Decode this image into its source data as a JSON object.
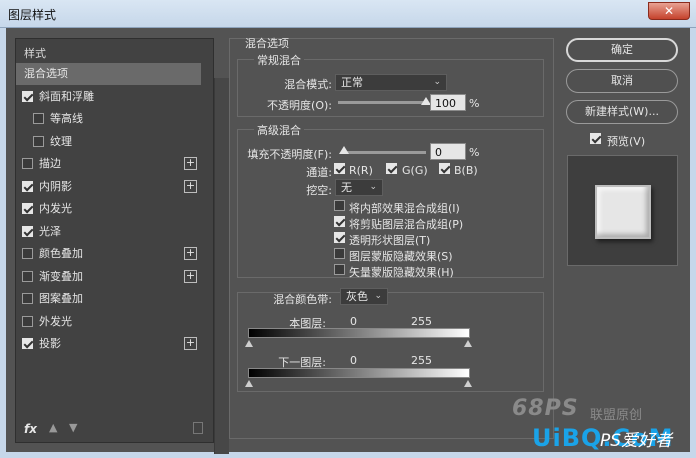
{
  "window": {
    "title": "图层样式",
    "close_label": "✕"
  },
  "left": {
    "header": "样式",
    "items": [
      {
        "label": "混合选项",
        "checkbox": false,
        "checked": false,
        "plus": false,
        "selected": true,
        "indent": 0
      },
      {
        "label": "斜面和浮雕",
        "checkbox": true,
        "checked": true,
        "plus": false,
        "selected": false,
        "indent": 0
      },
      {
        "label": "等高线",
        "checkbox": true,
        "checked": false,
        "plus": false,
        "selected": false,
        "indent": 1
      },
      {
        "label": "纹理",
        "checkbox": true,
        "checked": false,
        "plus": false,
        "selected": false,
        "indent": 1
      },
      {
        "label": "描边",
        "checkbox": true,
        "checked": false,
        "plus": true,
        "selected": false,
        "indent": 0
      },
      {
        "label": "内阴影",
        "checkbox": true,
        "checked": true,
        "plus": true,
        "selected": false,
        "indent": 0
      },
      {
        "label": "内发光",
        "checkbox": true,
        "checked": true,
        "plus": false,
        "selected": false,
        "indent": 0
      },
      {
        "label": "光泽",
        "checkbox": true,
        "checked": true,
        "plus": false,
        "selected": false,
        "indent": 0
      },
      {
        "label": "颜色叠加",
        "checkbox": true,
        "checked": false,
        "plus": true,
        "selected": false,
        "indent": 0
      },
      {
        "label": "渐变叠加",
        "checkbox": true,
        "checked": false,
        "plus": true,
        "selected": false,
        "indent": 0
      },
      {
        "label": "图案叠加",
        "checkbox": true,
        "checked": false,
        "plus": false,
        "selected": false,
        "indent": 0
      },
      {
        "label": "外发光",
        "checkbox": true,
        "checked": false,
        "plus": false,
        "selected": false,
        "indent": 0
      },
      {
        "label": "投影",
        "checkbox": true,
        "checked": true,
        "plus": true,
        "selected": false,
        "indent": 0
      }
    ],
    "footer": {
      "fx_label": "fx",
      "up_icon": "arrow-up-icon",
      "down_icon": "arrow-down-icon",
      "trash_icon": "trash-icon"
    }
  },
  "main": {
    "section_title": "混合选项",
    "general": {
      "title": "常规混合",
      "blend_mode_label": "混合模式:",
      "blend_mode_value": "正常",
      "opacity_label": "不透明度(O):",
      "opacity_value": "100",
      "opacity_fraction": 1.0,
      "unit": "%"
    },
    "advanced": {
      "title": "高级混合",
      "fill_opacity_label": "填充不透明度(F):",
      "fill_opacity_value": "0",
      "fill_opacity_fraction": 0.0,
      "unit": "%",
      "channels_label": "通道:",
      "channel_r": "R(R)",
      "channel_g": "G(G)",
      "channel_b": "B(B)",
      "knockout_label": "挖空:",
      "knockout_value": "无",
      "options": [
        {
          "label": "将内部效果混合成组(I)",
          "checked": false
        },
        {
          "label": "将剪贴图层混合成组(P)",
          "checked": true
        },
        {
          "label": "透明形状图层(T)",
          "checked": true
        },
        {
          "label": "图层蒙版隐藏效果(S)",
          "checked": false
        },
        {
          "label": "矢量蒙版隐藏效果(H)",
          "checked": false
        }
      ]
    },
    "blend_if": {
      "label": "混合颜色带:",
      "value": "灰色",
      "this_layer_label": "本图层:",
      "this_layer_min": "0",
      "this_layer_max": "255",
      "underlying_label": "下一图层:",
      "underlying_min": "0",
      "underlying_max": "255"
    }
  },
  "right": {
    "ok_label": "确定",
    "cancel_label": "取消",
    "new_style_label": "新建样式(W)...",
    "preview_label": "预览(V)",
    "preview_checked": true
  },
  "watermark": {
    "line1": "68PS",
    "line1b": "联盟原创",
    "line2": "UiBQ.CoM",
    "line2b": "PS爱好者"
  }
}
